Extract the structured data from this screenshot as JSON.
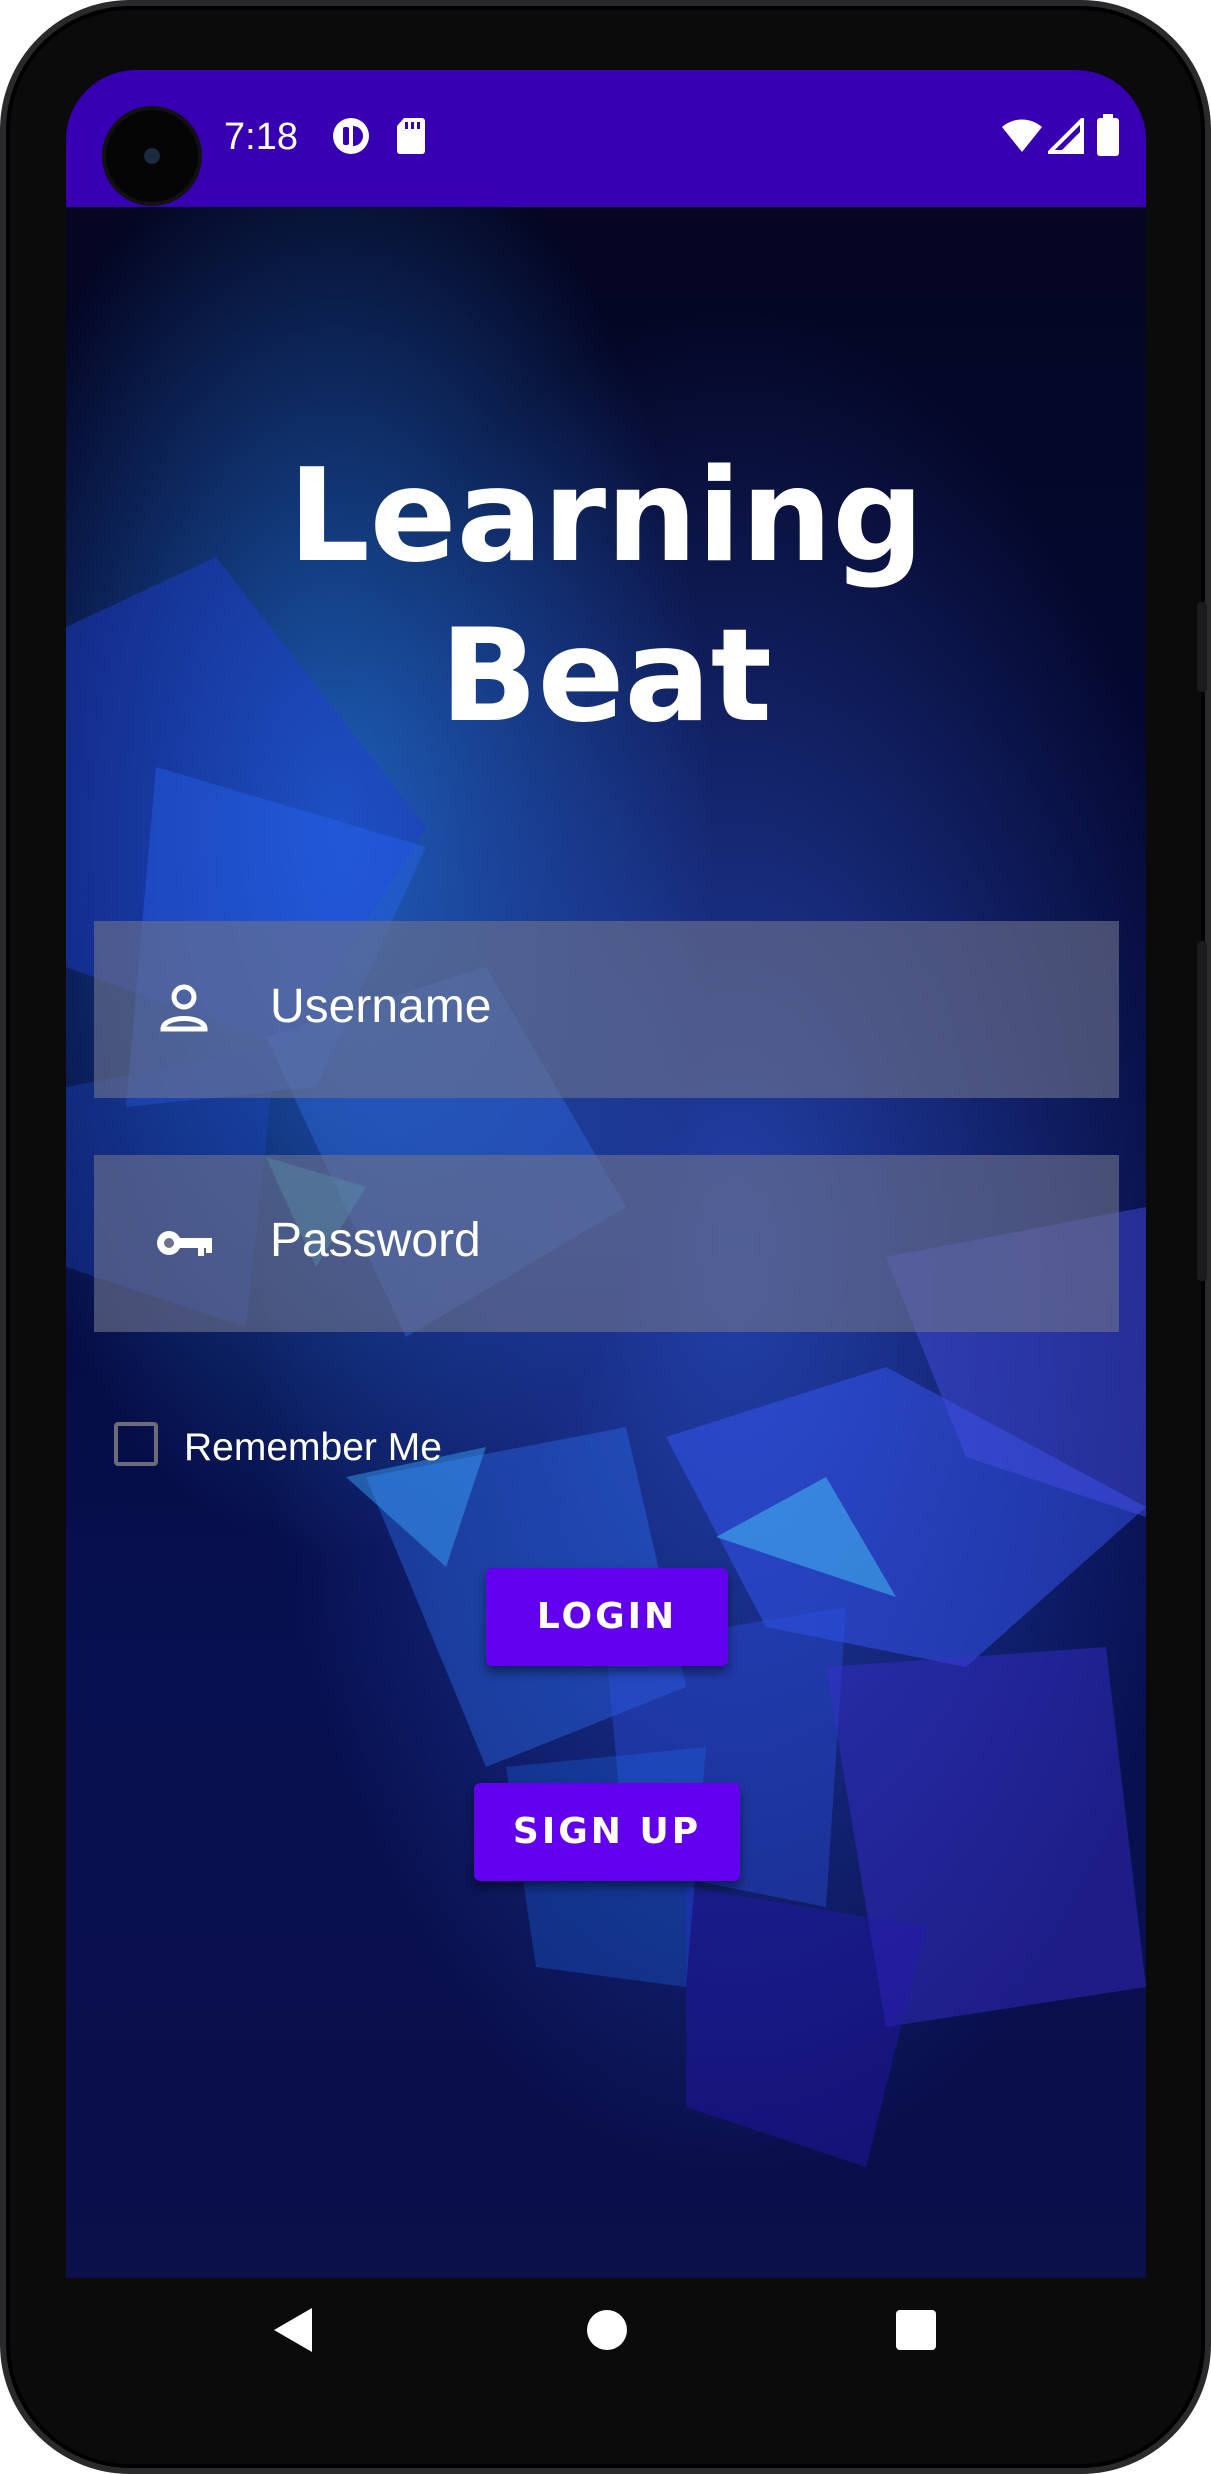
{
  "status_bar": {
    "time": "7:18",
    "icons": [
      "data-saver-icon",
      "sd-card-icon",
      "wifi-icon",
      "signal-icon",
      "battery-icon"
    ]
  },
  "app": {
    "title_line1": "Learning",
    "title_line2": "Beat"
  },
  "form": {
    "username_placeholder": "Username",
    "password_placeholder": "Password",
    "remember_label": "Remember Me",
    "remember_checked": false
  },
  "buttons": {
    "login_label": "LOGIN",
    "signup_label": "SIGN UP"
  },
  "navigation": {
    "items": [
      "back-icon",
      "home-icon",
      "recents-icon"
    ]
  },
  "colors": {
    "status_bar": "#3700b3",
    "button": "#6200ee",
    "background": "#06082a"
  }
}
